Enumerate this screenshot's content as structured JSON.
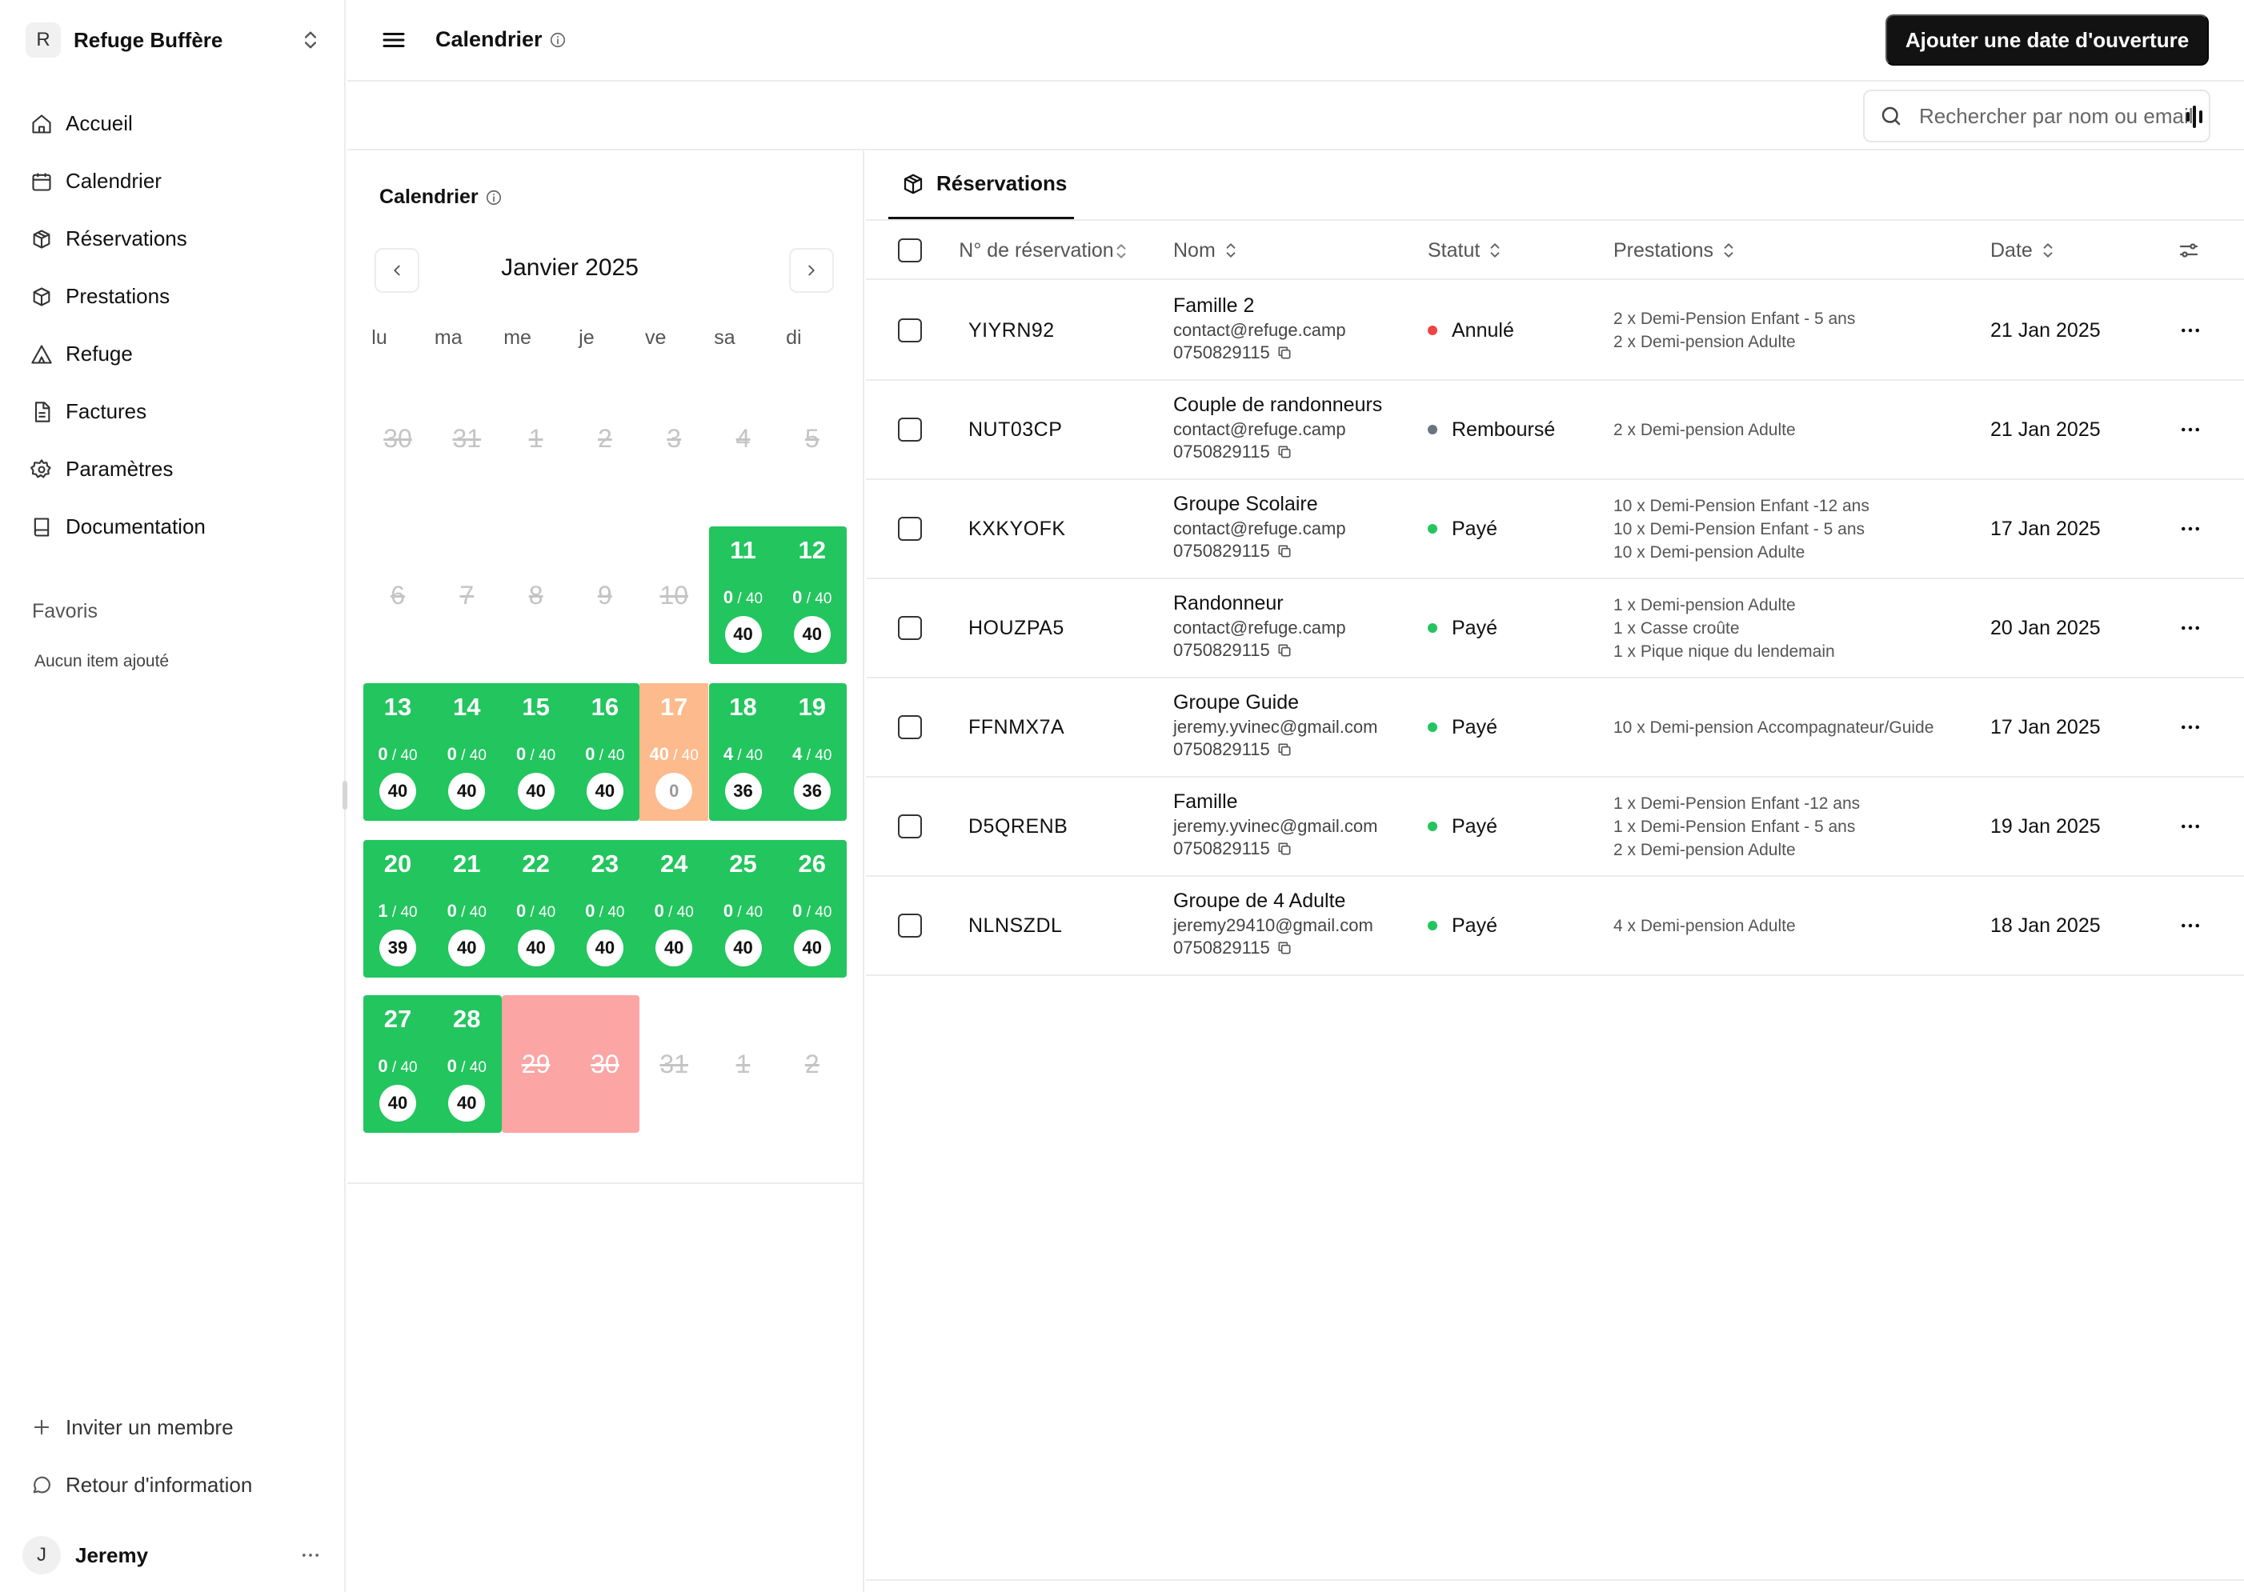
{
  "workspace": {
    "initial": "R",
    "name": "Refuge Buffère"
  },
  "nav": [
    {
      "label": "Accueil",
      "icon": "home-icon"
    },
    {
      "label": "Calendrier",
      "icon": "calendar-icon"
    },
    {
      "label": "Réservations",
      "icon": "boxes-icon"
    },
    {
      "label": "Prestations",
      "icon": "package-icon"
    },
    {
      "label": "Refuge",
      "icon": "tent-icon"
    },
    {
      "label": "Factures",
      "icon": "file-icon"
    },
    {
      "label": "Paramètres",
      "icon": "gear-icon"
    },
    {
      "label": "Documentation",
      "icon": "book-icon"
    }
  ],
  "favorites": {
    "title": "Favoris",
    "empty": "Aucun item ajouté"
  },
  "footer": {
    "invite": "Inviter un membre",
    "feedback": "Retour d'information"
  },
  "user": {
    "initial": "J",
    "name": "Jeremy"
  },
  "header": {
    "title": "Calendrier",
    "primary_button": "Ajouter une date d'ouverture"
  },
  "search": {
    "placeholder": "Rechercher par nom ou email"
  },
  "calendar": {
    "title": "Calendrier",
    "month": "Janvier 2025",
    "weekdays": [
      "lu",
      "ma",
      "me",
      "je",
      "ve",
      "sa",
      "di"
    ],
    "weeks": [
      [
        {
          "day": "30",
          "state": "muted"
        },
        {
          "day": "31",
          "state": "muted"
        },
        {
          "day": "1",
          "state": "muted"
        },
        {
          "day": "2",
          "state": "muted"
        },
        {
          "day": "3",
          "state": "muted"
        },
        {
          "day": "4",
          "state": "muted"
        },
        {
          "day": "5",
          "state": "muted"
        }
      ],
      [
        {
          "day": "6",
          "state": "muted"
        },
        {
          "day": "7",
          "state": "muted"
        },
        {
          "day": "8",
          "state": "muted"
        },
        {
          "day": "9",
          "state": "muted"
        },
        {
          "day": "10",
          "state": "muted"
        },
        {
          "day": "11",
          "state": "open",
          "booked": "0",
          "capacity": "/ 40",
          "free": "40"
        },
        {
          "day": "12",
          "state": "open",
          "booked": "0",
          "capacity": "/ 40",
          "free": "40"
        }
      ],
      [
        {
          "day": "13",
          "state": "open",
          "booked": "0",
          "capacity": "/ 40",
          "free": "40"
        },
        {
          "day": "14",
          "state": "open",
          "booked": "0",
          "capacity": "/ 40",
          "free": "40"
        },
        {
          "day": "15",
          "state": "open",
          "booked": "0",
          "capacity": "/ 40",
          "free": "40"
        },
        {
          "day": "16",
          "state": "open",
          "booked": "0",
          "capacity": "/ 40",
          "free": "40"
        },
        {
          "day": "17",
          "state": "full",
          "booked": "40",
          "capacity": "/ 40",
          "free": "0"
        },
        {
          "day": "18",
          "state": "open",
          "booked": "4",
          "capacity": "/ 40",
          "free": "36"
        },
        {
          "day": "19",
          "state": "open",
          "booked": "4",
          "capacity": "/ 40",
          "free": "36"
        }
      ],
      [
        {
          "day": "20",
          "state": "open",
          "booked": "1",
          "capacity": "/ 40",
          "free": "39"
        },
        {
          "day": "21",
          "state": "open",
          "booked": "0",
          "capacity": "/ 40",
          "free": "40"
        },
        {
          "day": "22",
          "state": "open",
          "booked": "0",
          "capacity": "/ 40",
          "free": "40"
        },
        {
          "day": "23",
          "state": "open",
          "booked": "0",
          "capacity": "/ 40",
          "free": "40"
        },
        {
          "day": "24",
          "state": "open",
          "booked": "0",
          "capacity": "/ 40",
          "free": "40"
        },
        {
          "day": "25",
          "state": "open",
          "booked": "0",
          "capacity": "/ 40",
          "free": "40"
        },
        {
          "day": "26",
          "state": "open",
          "booked": "0",
          "capacity": "/ 40",
          "free": "40"
        }
      ],
      [
        {
          "day": "27",
          "state": "open",
          "booked": "0",
          "capacity": "/ 40",
          "free": "40"
        },
        {
          "day": "28",
          "state": "open",
          "booked": "0",
          "capacity": "/ 40",
          "free": "40"
        },
        {
          "day": "29",
          "state": "closed"
        },
        {
          "day": "30",
          "state": "closed"
        },
        {
          "day": "31",
          "state": "muted"
        },
        {
          "day": "1",
          "state": "muted"
        },
        {
          "day": "2",
          "state": "muted"
        }
      ]
    ],
    "colors": {
      "open": "#22c55e",
      "full": "#fdba8c",
      "closed": "#fca5a5"
    }
  },
  "reservations": {
    "tab": "Réservations",
    "columns": {
      "number": "N° de réservation",
      "name": "Nom",
      "status": "Statut",
      "services": "Prestations",
      "date": "Date"
    },
    "rows": [
      {
        "id": "YIYRN92",
        "name": "Famille 2",
        "email": "contact@refuge.camp",
        "phone": "0750829115",
        "status": "Annulé",
        "status_color": "#ef4444",
        "services": [
          "2 x Demi-Pension Enfant - 5 ans",
          "2 x Demi-pension Adulte"
        ],
        "date": "21 Jan 2025"
      },
      {
        "id": "NUT03CP",
        "name": "Couple de randonneurs",
        "email": "contact@refuge.camp",
        "phone": "0750829115",
        "status": "Remboursé",
        "status_color": "#6b7280",
        "services": [
          "2 x Demi-pension Adulte"
        ],
        "date": "21 Jan 2025"
      },
      {
        "id": "KXKYOFK",
        "name": "Groupe Scolaire",
        "email": "contact@refuge.camp",
        "phone": "0750829115",
        "status": "Payé",
        "status_color": "#22c55e",
        "services": [
          "10 x Demi-Pension Enfant -12 ans",
          "10 x Demi-Pension Enfant - 5 ans",
          "10 x Demi-pension Adulte"
        ],
        "date": "17 Jan 2025"
      },
      {
        "id": "HOUZPA5",
        "name": "Randonneur",
        "email": "contact@refuge.camp",
        "phone": "0750829115",
        "status": "Payé",
        "status_color": "#22c55e",
        "services": [
          "1 x Demi-pension Adulte",
          "1 x Casse croûte",
          "1 x Pique nique du lendemain"
        ],
        "date": "20 Jan 2025"
      },
      {
        "id": "FFNMX7A",
        "name": "Groupe Guide",
        "email": "jeremy.yvinec@gmail.com",
        "phone": "0750829115",
        "status": "Payé",
        "status_color": "#22c55e",
        "services": [
          "10 x Demi-pension Accompagnateur/Guide"
        ],
        "date": "17 Jan 2025"
      },
      {
        "id": "D5QRENB",
        "name": "Famille",
        "email": "jeremy.yvinec@gmail.com",
        "phone": "0750829115",
        "status": "Payé",
        "status_color": "#22c55e",
        "services": [
          "1 x Demi-Pension Enfant -12 ans",
          "1 x Demi-Pension Enfant - 5 ans",
          "2 x Demi-pension Adulte"
        ],
        "date": "19 Jan 2025"
      },
      {
        "id": "NLNSZDL",
        "name": "Groupe de 4 Adulte",
        "email": "jeremy29410@gmail.com",
        "phone": "0750829115",
        "status": "Payé",
        "status_color": "#22c55e",
        "services": [
          "4 x Demi-pension Adulte"
        ],
        "date": "18 Jan 2025"
      }
    ]
  }
}
